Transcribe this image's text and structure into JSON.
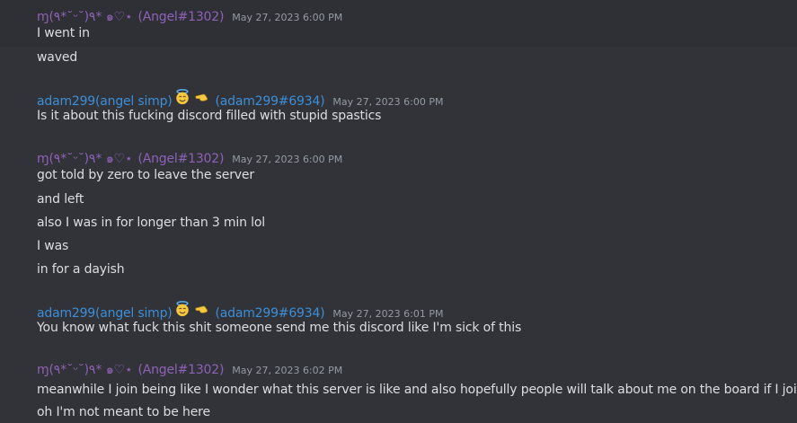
{
  "messages": [
    {
      "author": "ɱ(٩*˘ᵕ˘)٩* ๑♡⋆",
      "tag": "(Angel#1302)",
      "timestamp": "May 27, 2023 6:00 PM",
      "lines": [
        "I went in",
        "waved"
      ]
    },
    {
      "author": "adam299(angel simp)",
      "tag": "(adam299#6934)",
      "timestamp": "May 27, 2023 6:00 PM",
      "lines": [
        "Is it about this fucking discord filled with stupid spastics"
      ]
    },
    {
      "author": "ɱ(٩*˘ᵕ˘)٩* ๑♡⋆",
      "tag": "(Angel#1302)",
      "timestamp": "May 27, 2023 6:00 PM",
      "lines": [
        "got told by zero to leave the server",
        "and left",
        "also I was in for longer than 3 min lol",
        "I was",
        "in for a dayish"
      ]
    },
    {
      "author": "adam299(angel simp)",
      "tag": "(adam299#6934)",
      "timestamp": "May 27, 2023 6:01 PM",
      "lines": [
        "You know what fuck this shit someone send me this discord like I'm sick of this"
      ]
    },
    {
      "author": "ɱ(٩*˘ᵕ˘)٩* ๑♡⋆",
      "tag": "(Angel#1302)",
      "timestamp": "May 27, 2023 6:02 PM",
      "lines": [
        "meanwhile I join being like I wonder what this server is like and also hopefully people will talk about me on the board if I join",
        "oh I'm not meant to be here"
      ]
    }
  ],
  "icons": {
    "angel_face_emoji": "smiling-face-with-halo",
    "pointing_hand_emoji": "backhand-index-pointing-left"
  },
  "colors": {
    "background": "#313338",
    "angel_name": "#8f62b7",
    "adam_name": "#3c8fd8",
    "message_text": "#dbdee1",
    "timestamp": "#949ba4"
  }
}
